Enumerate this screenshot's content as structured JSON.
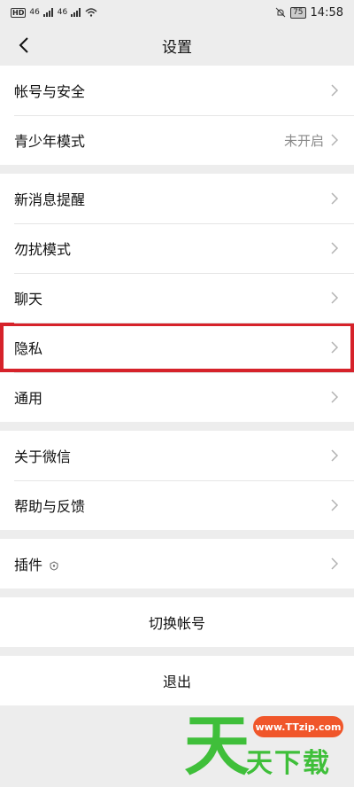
{
  "status_bar": {
    "left_chips": [
      "HD",
      "46",
      "46"
    ],
    "time": "14:58",
    "battery": "75"
  },
  "header": {
    "title": "设置"
  },
  "groups": [
    [
      {
        "label": "帐号与安全"
      },
      {
        "label": "青少年模式",
        "value": "未开启"
      }
    ],
    [
      {
        "label": "新消息提醒"
      },
      {
        "label": "勿扰模式"
      },
      {
        "label": "聊天"
      },
      {
        "label": "隐私"
      },
      {
        "label": "通用"
      }
    ],
    [
      {
        "label": "关于微信"
      },
      {
        "label": "帮助与反馈"
      }
    ],
    [
      {
        "label": "插件"
      }
    ]
  ],
  "actions": {
    "switch_account": "切换帐号",
    "logout": "退出"
  },
  "watermark": {
    "url": "www.TTzip.com",
    "big": "天",
    "sub": "天下载"
  },
  "colors": {
    "highlight": "#d6222a",
    "watermark_green": "#3fbf3a",
    "watermark_orange": "#f0562a"
  }
}
